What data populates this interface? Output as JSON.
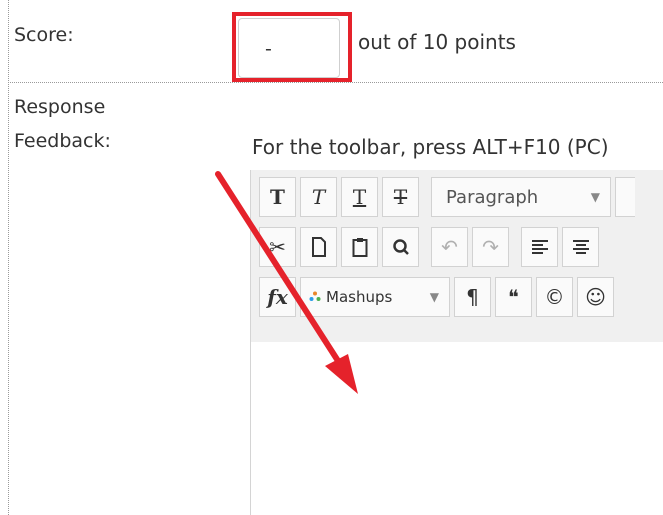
{
  "form": {
    "score_label": "Score:",
    "score_value": "-",
    "out_of_text": "out of 10 points",
    "feedback_label_line1": "Response",
    "feedback_label_line2": "Feedback:"
  },
  "editor": {
    "toolbar_hint": "For the toolbar, press ALT+F10 (PC)",
    "format_dropdown": "Paragraph",
    "mashups_dropdown": "Mashups"
  },
  "colors": {
    "highlight": "#e5222b",
    "arrow": "#e5222b"
  }
}
